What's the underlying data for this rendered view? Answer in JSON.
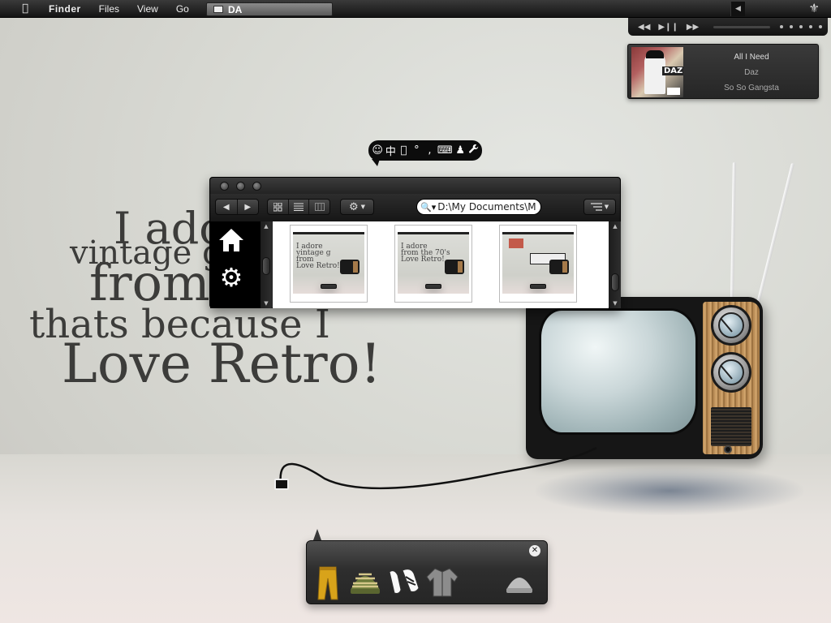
{
  "menubar": {
    "apple_icon": "apple-logo",
    "app_name": "Finder",
    "menus": [
      "Files",
      "View",
      "Go"
    ],
    "active_task": "DA",
    "tray_icon": "fleur-de-lis"
  },
  "media": {
    "controls": [
      "◀◀",
      "▶❙❙",
      "▶▶"
    ],
    "now_playing": {
      "song": "All I Need",
      "artist": "Daz",
      "album": "So So Gangsta",
      "album_logo_text": "DAZ"
    }
  },
  "wallpaper": {
    "lines": [
      "I adore",
      "vintage g",
      "from",
      "thats because I",
      "Love Retro!"
    ]
  },
  "bubble": {
    "icons": [
      "smiley-icon",
      "chinese-input-icon",
      "apple-icon",
      "degree-icon",
      "comma-icon",
      "keyboard-icon",
      "person-icon",
      "wrench-icon"
    ],
    "glyphs": [
      "☺",
      "中",
      "",
      "°",
      ",",
      "⌨",
      "♟",
      "🔧"
    ]
  },
  "finder": {
    "search_value": "D:\\My Documents\\M",
    "view_modes": [
      "icon-view",
      "list-view",
      "column-view"
    ],
    "sidebar": [
      "home-icon",
      "gear-icon"
    ],
    "items": [
      {
        "name": "screenshot-1"
      },
      {
        "name": "screenshot-2"
      },
      {
        "name": "screenshot-3"
      }
    ]
  },
  "dock": {
    "items": [
      "yellow-pants",
      "striped-beanie",
      "sneakers",
      "jacket",
      "grey-beanie"
    ]
  },
  "colors": {
    "menubar_bg": "#1a1a1a",
    "wallpaper_text": "#3c3c3a",
    "finder_bg": "#222222",
    "tv_wood": "#c99a60"
  }
}
